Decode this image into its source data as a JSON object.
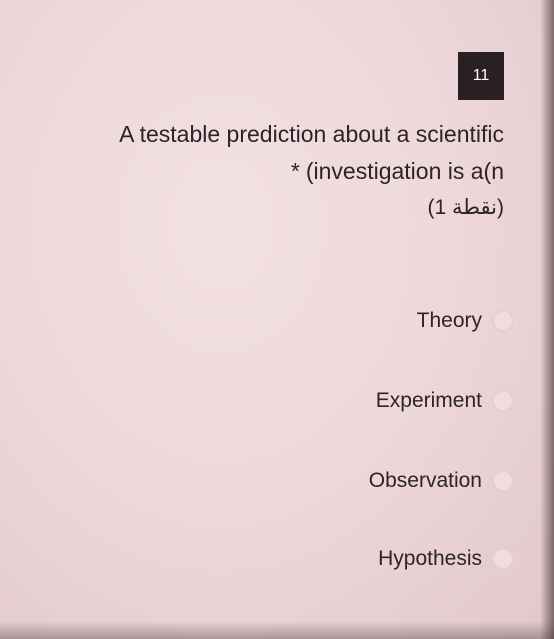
{
  "question": {
    "number": "11",
    "line1": "A testable prediction about a scientific",
    "required_mark": "*",
    "line2": "(investigation is a(n",
    "points": "(1 نقطة)"
  },
  "options": [
    {
      "label": "Theory",
      "selected": false
    },
    {
      "label": "Experiment",
      "selected": false
    },
    {
      "label": "Observation",
      "selected": false
    },
    {
      "label": "Hypothesis",
      "selected": false
    }
  ]
}
